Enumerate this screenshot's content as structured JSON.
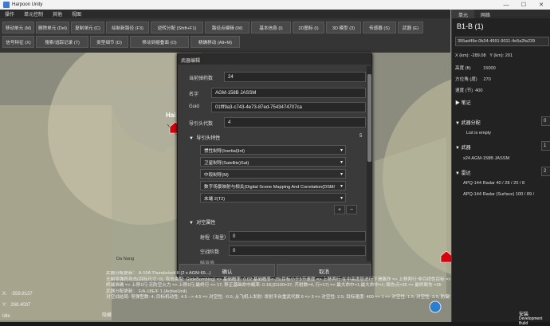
{
  "window": {
    "title": "Harpoon Unity",
    "min": "—",
    "max": "☐",
    "close": "✕"
  },
  "menu": [
    "操作",
    "单元控制",
    "其他",
    "视图"
  ],
  "toolbar": {
    "row1": [
      "移动单元 (M)",
      "删除单元 (Del)",
      "复制单元 (C)",
      "绘制新路径 (F3)",
      "逆转分配 (Shift+F1)",
      "路径点编辑 (W)",
      "基本信息 (I)",
      "2D图标 (I)",
      "3D 模型 (3)",
      "传感器 (S)",
      "武器 (E)"
    ],
    "row2": [
      "信号特征 (X)",
      "搜索/追踪记录 (T)",
      "类型细节 (D)",
      "移动到缩叠面 (O)",
      "精确移动 (Alt+M)"
    ]
  },
  "right_panel": {
    "tabs": [
      "单元",
      "网络"
    ],
    "title": "B1-B (1)",
    "guid": "355ad49e-0b34-4991-9011-4e5a2fa239",
    "x_label": "X (km):",
    "x_value": "-289.08",
    "y_label": "Y (km):",
    "y_value": "201",
    "alt_label": "高度 (ft)",
    "alt_value": "15000",
    "heading_label": "方位角 (度)",
    "heading_value": "270",
    "speed_label": "速度 (节)",
    "speed_value": "400",
    "notes_label": "笔记",
    "weapon_assign_label": "武器分配",
    "weapon_assign_value": "0",
    "list_empty": "List is empty",
    "weapons_label": "武器",
    "weapons_value": "1",
    "weapon_item": "x24   AGM-158B JASSM",
    "radar_label": "雷达",
    "radar_value": "2",
    "radar1": "APQ-144 Radar   40  /  28  /  20  /  8",
    "radar2": "APQ-144 Radar (Surface)   100  /  89  /"
  },
  "dialog": {
    "title": "武器编辑",
    "current_ammo_label": "当前弹药数",
    "current_ammo_value": "24",
    "name_label": "名字",
    "name_value": "AGM-158B JASSM",
    "guid_label": "Guid",
    "guid_value": "01fff9a3-c743-4e73-87ed-7543474707ca",
    "seeker_gen_label": "导引头代数",
    "seeker_gen_value": "4",
    "seeker_section": "导引头特性",
    "seeker_count": "5",
    "seekers": [
      "惯性制导(Inertial)Int)",
      "卫星制导(Satellite)Sat)",
      "中段制导(M)",
      "数字场景映射与相关(Digital Scene Mapping And Correlation(DSM/",
      "末端 2(T2)"
    ],
    "plus": "+",
    "minus": "−",
    "anti_ship_section": "对空属性",
    "range_label": "射程（海里）",
    "range_value": "0",
    "aa_stage_label": "空战阶数",
    "aa_stage_value": "0",
    "partial_label": "瞄准值 ...",
    "ok": "确认",
    "cancel": "取消"
  },
  "log": [
    "武器分配更新： A-10A Thunderbolt II (2 x AGM-65...)",
    "无制导弹药攻击(目标尺寸: 0), 攻击类型: GlideBombing) => 基础概率: 0.02;基础概率<-25(目标小于5节速度 => 上移两行:在中高度层进行下滑轰炸 => 上移两行:非目视性目标 => 上移两行:障碍/飘",
    "终端准确 => 上移1行;无防空火力 => 上移1行;最终行 => 17, 移正基础命中概率: 0.18;(D100=37, 齐射数=4, 行=17) => 最大命中=1;最大命中=1;  毁伤点=35 => 最终毁伤 =35",
    "武器分配更新：  F/A-18E/F 1 (ActiveUnit)",
    "对空战结局: 导弹型数: 4; 目标机动性: 4.5 --> 4.5 => 对空性: -0.5; 从飞机上发射: 发射平台重武代数 6 => 3 => 对空性: 2.5; 目标速度: 400 => 1 => 对空性: 1.5; 对空性: 3.5; 防御性能: 0 => 对空性: 3.5; 防御性能: 0"
  ],
  "status": {
    "x_label": "X:",
    "x_value": "-559.8137",
    "y_label": "Y:",
    "y_value": "268.4037",
    "state": "Idle",
    "bottom_tab": "隐藏"
  },
  "map_labels": {
    "hai": "Hai",
    "danang": "Da Nang"
  },
  "footer": {
    "install": "安装",
    "dev": "Development Build"
  }
}
